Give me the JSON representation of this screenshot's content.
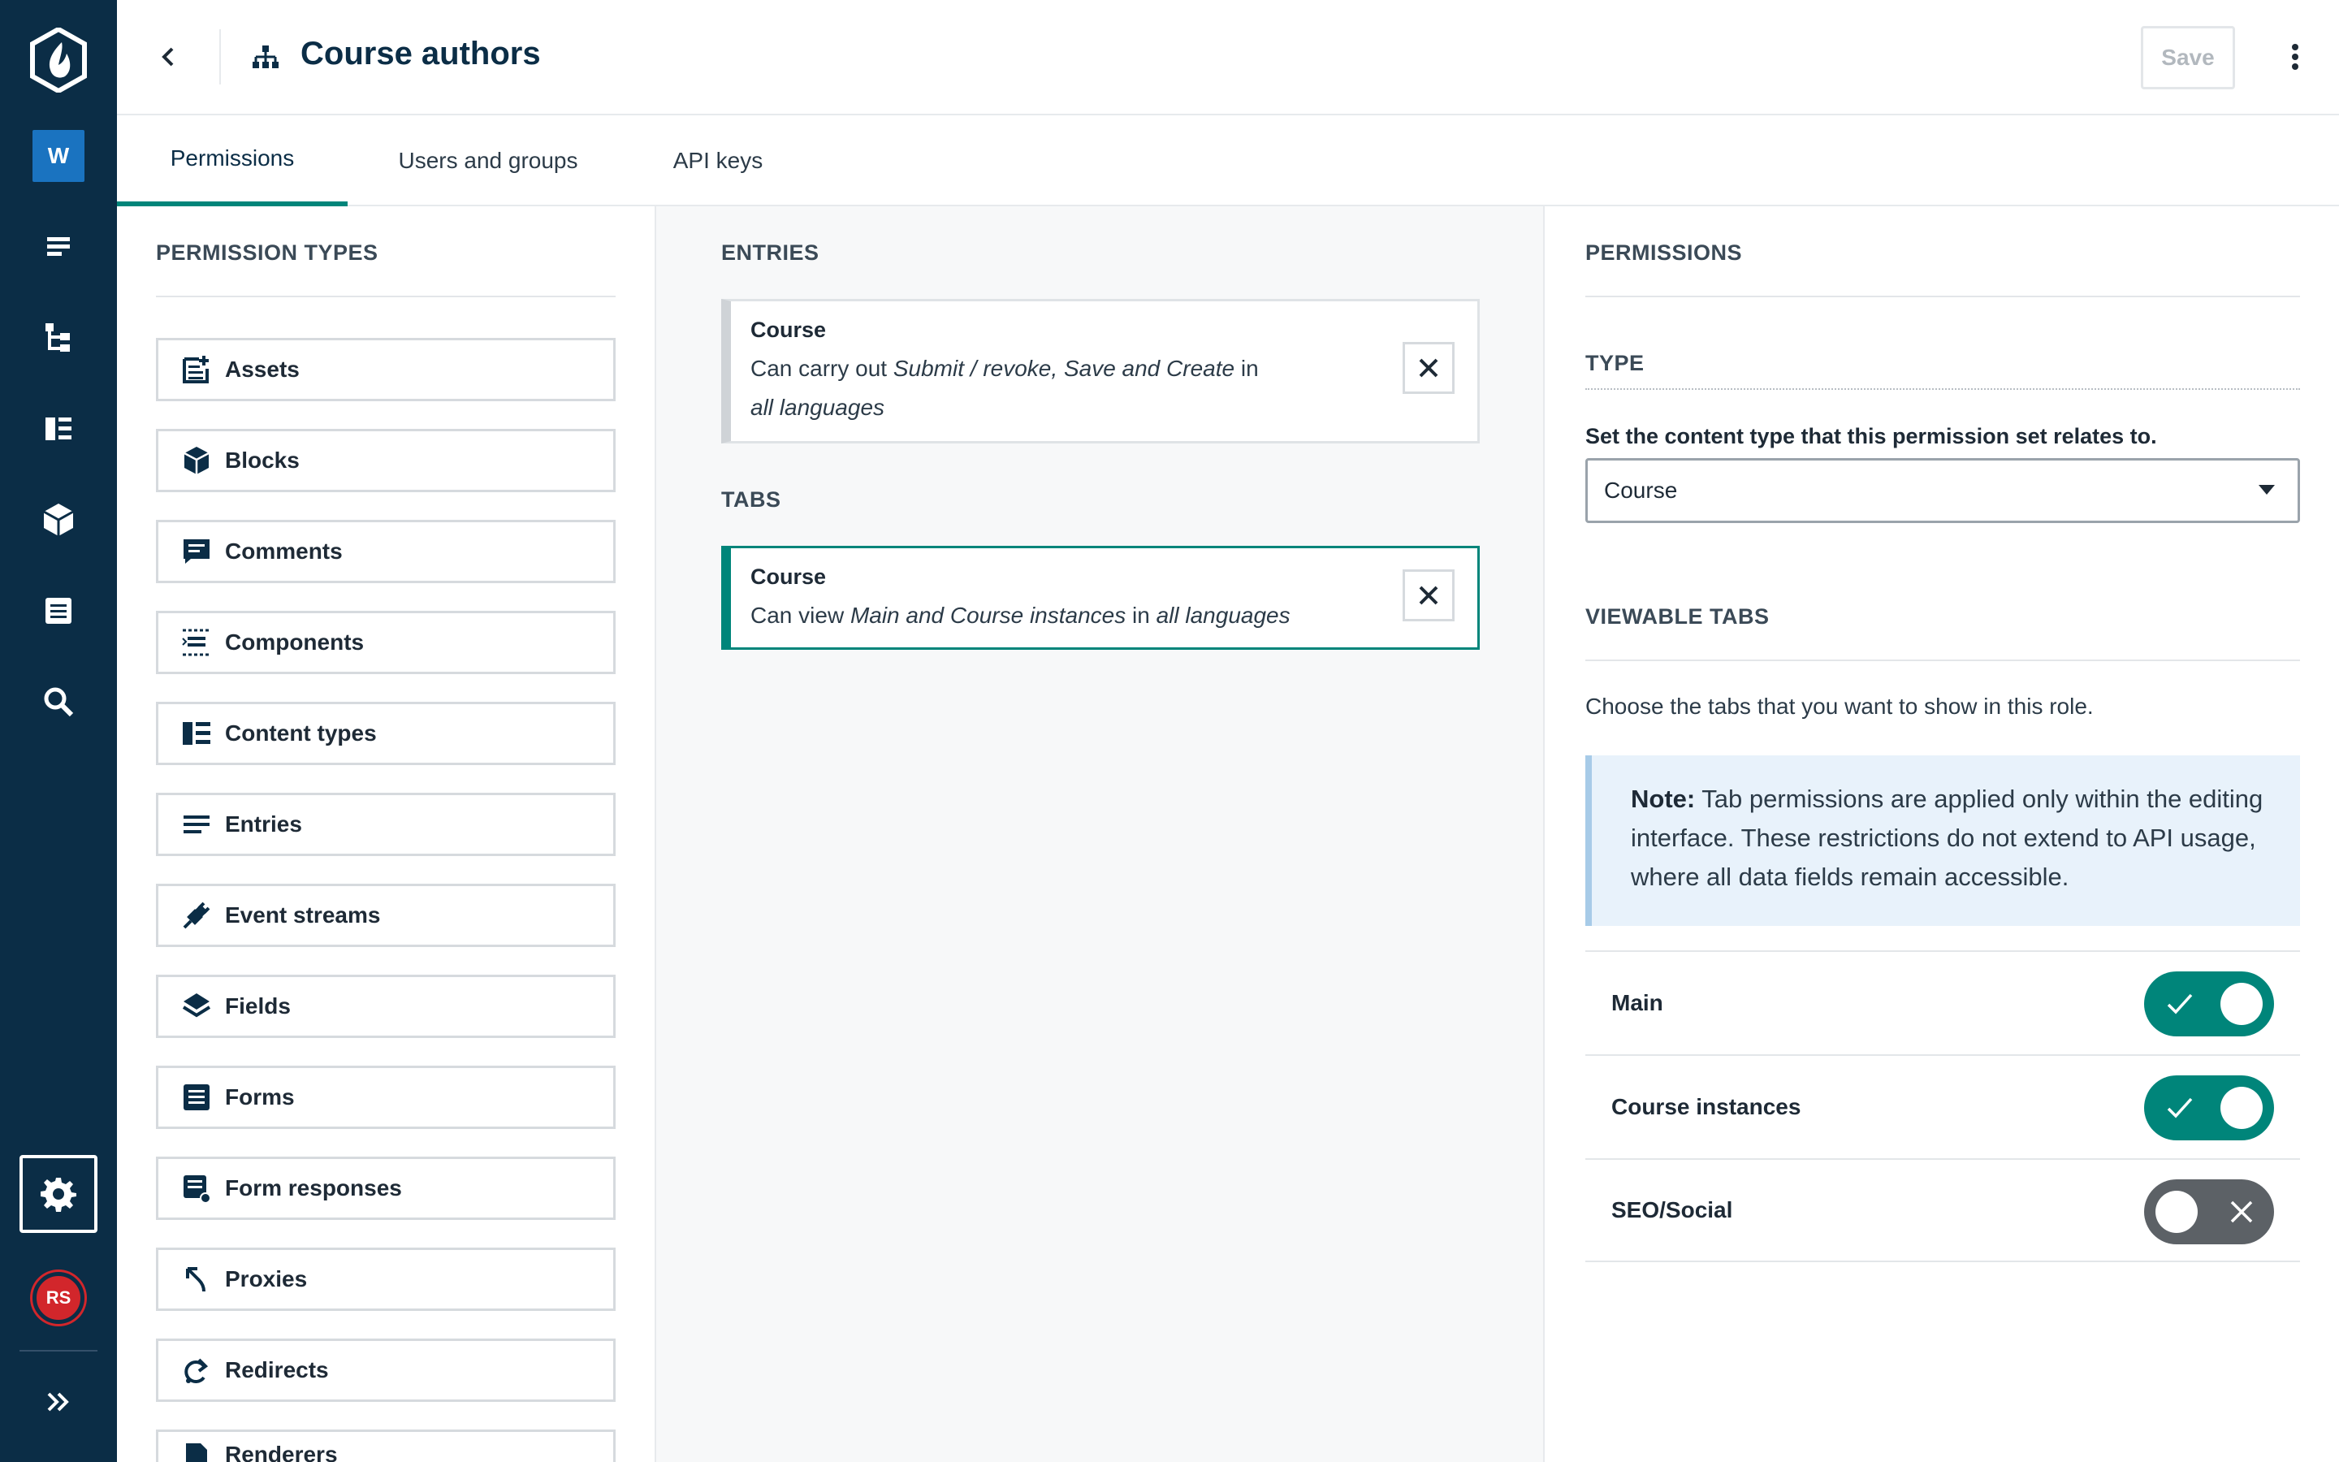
{
  "app": {
    "workspace_badge": "W",
    "user_initials": "RS"
  },
  "header": {
    "title": "Course authors",
    "save_label": "Save"
  },
  "tabs": [
    {
      "label": "Permissions",
      "active": true
    },
    {
      "label": "Users and groups",
      "active": false
    },
    {
      "label": "API keys",
      "active": false
    }
  ],
  "permission_types": {
    "heading": "PERMISSION TYPES",
    "items": [
      {
        "label": "Assets",
        "icon": "asset-icon"
      },
      {
        "label": "Blocks",
        "icon": "cube-icon"
      },
      {
        "label": "Comments",
        "icon": "comment-icon"
      },
      {
        "label": "Components",
        "icon": "components-icon"
      },
      {
        "label": "Content types",
        "icon": "content-type-icon"
      },
      {
        "label": "Entries",
        "icon": "entries-icon"
      },
      {
        "label": "Event streams",
        "icon": "plug-icon"
      },
      {
        "label": "Fields",
        "icon": "layers-icon"
      },
      {
        "label": "Forms",
        "icon": "form-icon"
      },
      {
        "label": "Form responses",
        "icon": "form-response-icon"
      },
      {
        "label": "Proxies",
        "icon": "proxy-arrow-icon"
      },
      {
        "label": "Redirects",
        "icon": "redirect-icon"
      },
      {
        "label": "Renderers",
        "icon": "file-icon"
      }
    ]
  },
  "entries": {
    "heading": "ENTRIES",
    "card": {
      "title": "Course",
      "prefix": "Can carry out ",
      "actions": "Submit / revoke, Save and Create",
      "mid": " in ",
      "scope": "all languages"
    }
  },
  "tabs_section": {
    "heading": "TABS",
    "card": {
      "title": "Course",
      "prefix": "Can view ",
      "actions": "Main and Course instances",
      "mid": " in ",
      "scope": "all languages"
    }
  },
  "permissions_panel": {
    "heading": "PERMISSIONS",
    "type_heading": "TYPE",
    "type_label": "Set the content type that this permission set relates to.",
    "type_value": "Course",
    "viewable_heading": "VIEWABLE TABS",
    "viewable_help": "Choose the tabs that you want to show in this role.",
    "note_bold": "Note:",
    "note_text": " Tab permissions are applied only within the editing interface. These restrictions do not extend to API usage, where all data fields remain accessible.",
    "toggles": [
      {
        "label": "Main",
        "on": true
      },
      {
        "label": "Course instances",
        "on": true
      },
      {
        "label": "SEO/Social",
        "on": false
      }
    ]
  },
  "colors": {
    "rail": "#0b2d46",
    "accent": "#00857a",
    "toggle_off": "#5c6166",
    "note_bg": "#e8f2fb"
  }
}
